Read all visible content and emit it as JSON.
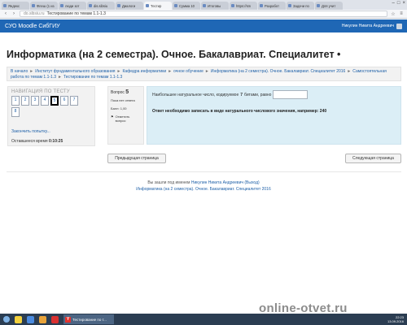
{
  "browser": {
    "tabs": [
      {
        "label": "Яндекс"
      },
      {
        "label": "Флеш (1 из"
      },
      {
        "label": "люди зот"
      },
      {
        "label": "dis.sibsiu"
      },
      {
        "label": "Диалоги"
      },
      {
        "label": "Тестир",
        "active": true
      },
      {
        "label": "Сумма 10"
      },
      {
        "label": "Итоговы"
      },
      {
        "label": "https://sm"
      },
      {
        "label": "Разработ"
      },
      {
        "label": "Задачи по"
      },
      {
        "label": "Для учит"
      }
    ],
    "url_host": "do.sibsiu.ru",
    "url_title": "Тестирование по темам 1.1-1.3"
  },
  "header": {
    "brand": "СУО Moodle СибГИУ",
    "user_name": "Никулин Никита Андреевич"
  },
  "page_title": "Информатика (на 2 семестра). Очное. Бакалавриат. Специалитет •",
  "breadcrumb": {
    "items": [
      "В начало",
      "Институт фундаментального образования",
      "Кафедра информатики",
      "очное обучение",
      "Информатика (на 2 семестра). Очное. Бакалавриат. Специалитет 2016",
      "Самостоятельная работа по темам 1.1-1.3",
      "Тестирование по темам 1.1-1.3"
    ]
  },
  "quiz_nav": {
    "heading": "НАВИГАЦИЯ ПО ТЕСТУ",
    "questions": [
      "1",
      "2",
      "3",
      "4",
      "5",
      "6",
      "7",
      "8"
    ],
    "current": 5,
    "finish_label": "Закончить попытку...",
    "timer_label": "Оставшееся время",
    "timer_value": "0:10:25"
  },
  "question_info": {
    "label": "Вопрос",
    "number": "5",
    "status": "Пока нет ответа",
    "grade": "Балл: 1,00",
    "flag": "Отметить вопрос"
  },
  "question": {
    "text_before": "Наибольшее натуральное число, кодируемое",
    "bits": "7",
    "text_after": "битами, равно",
    "hint": "Ответ необходимо записать в виде натурального числового значения, например: 240"
  },
  "buttons": {
    "prev": "Предыдущая страница",
    "next": "Следующая страница"
  },
  "footer": {
    "logged_in_prefix": "Вы зашли под именем",
    "user_name": "Никулин Никита Андреевич",
    "logout": "(Выход)",
    "course": "Информатика (на 2 семестра). Очное. Бакалавриат. Специалитет 2016"
  },
  "taskbar": {
    "active_task": "Тестирование по т...",
    "time": "22:23",
    "date": "13.09.2016"
  },
  "watermark": "online-otvet.ru",
  "colors": {
    "header_blue": "#1f67b5",
    "link_blue": "#1e60a8",
    "question_bg": "#dbeef6"
  }
}
